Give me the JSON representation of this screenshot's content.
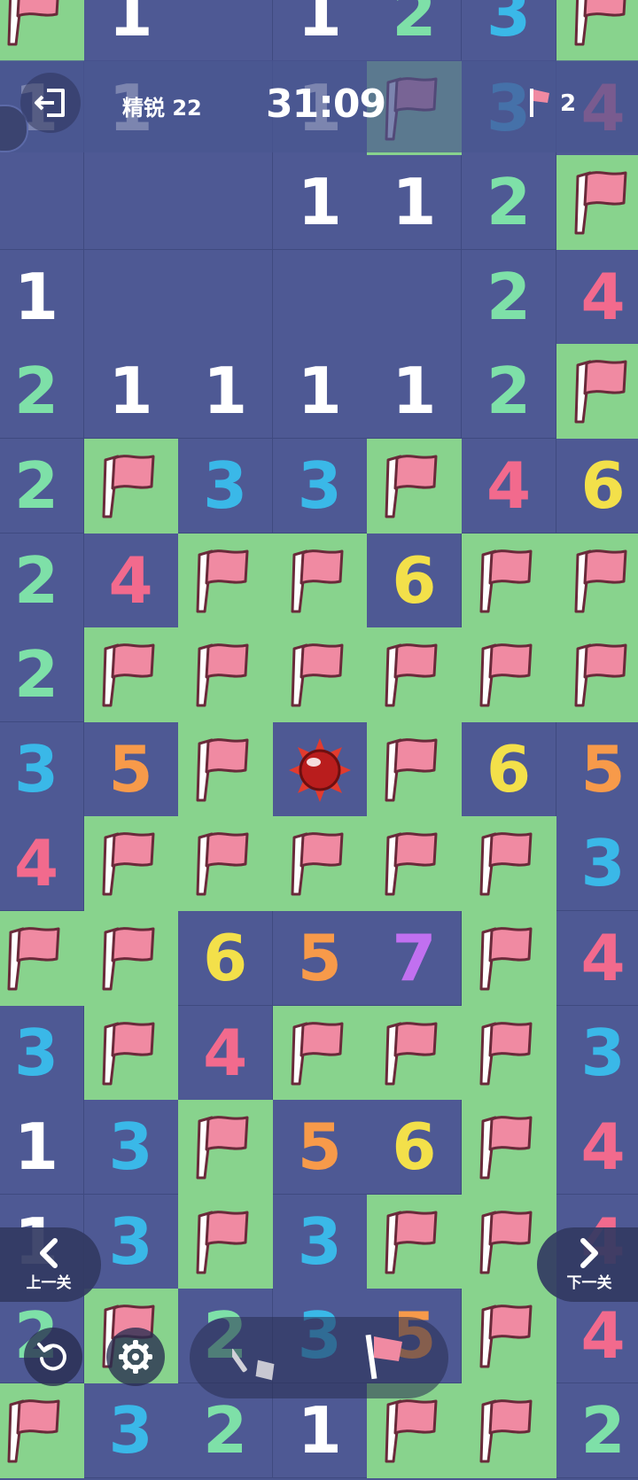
{
  "header": {
    "level_label": "精锐 22",
    "timer": "31:09",
    "flags_remaining": "2"
  },
  "navigation": {
    "prev_label": "上一关",
    "next_label": "下一关"
  },
  "colors": {
    "1": "#ffffff",
    "2": "#7ee0a8",
    "3": "#3ab8e8",
    "4": "#f26a8d",
    "5": "#f79a4a",
    "6": "#f3e04a",
    "7": "#c170f0",
    "flag_cell": "#88d38d",
    "revealed_cell": "#4e5994",
    "flag_red": "#f08aa2"
  },
  "board": {
    "rows": [
      [
        "F",
        "1",
        "E",
        "1",
        "2",
        "3",
        "F"
      ],
      [
        "1",
        "1",
        "E",
        "1",
        "F",
        "3",
        "4"
      ],
      [
        "E",
        "E",
        "E",
        "1",
        "1",
        "2",
        "F"
      ],
      [
        "1",
        "E",
        "E",
        "E",
        "E",
        "2",
        "4"
      ],
      [
        "2",
        "1",
        "1",
        "1",
        "1",
        "2",
        "F"
      ],
      [
        "2",
        "F",
        "3",
        "3",
        "F",
        "4",
        "6"
      ],
      [
        "2",
        "4",
        "F",
        "F",
        "6",
        "F",
        "F"
      ],
      [
        "2",
        "F",
        "F",
        "F",
        "F",
        "F",
        "F"
      ],
      [
        "3",
        "5",
        "F",
        "M",
        "F",
        "6",
        "5"
      ],
      [
        "4",
        "F",
        "F",
        "F",
        "F",
        "F",
        "3"
      ],
      [
        "F",
        "F",
        "6",
        "5",
        "7",
        "F",
        "4"
      ],
      [
        "3",
        "F",
        "4",
        "F",
        "F",
        "F",
        "3"
      ],
      [
        "1",
        "3",
        "F",
        "5",
        "6",
        "F",
        "4"
      ],
      [
        "1",
        "3",
        "F",
        "3",
        "F",
        "F",
        "4"
      ],
      [
        "2",
        "F",
        "2",
        "3",
        "5",
        "F",
        "4"
      ],
      [
        "F",
        "3",
        "2",
        "1",
        "F",
        "F",
        "2"
      ]
    ]
  },
  "icons": {
    "exit": "exit-icon",
    "undo": "undo-icon",
    "settings": "gear-icon",
    "dig": "shovel-icon",
    "flag": "flag-icon",
    "prev": "chevron-left-icon",
    "next": "chevron-right-icon"
  }
}
